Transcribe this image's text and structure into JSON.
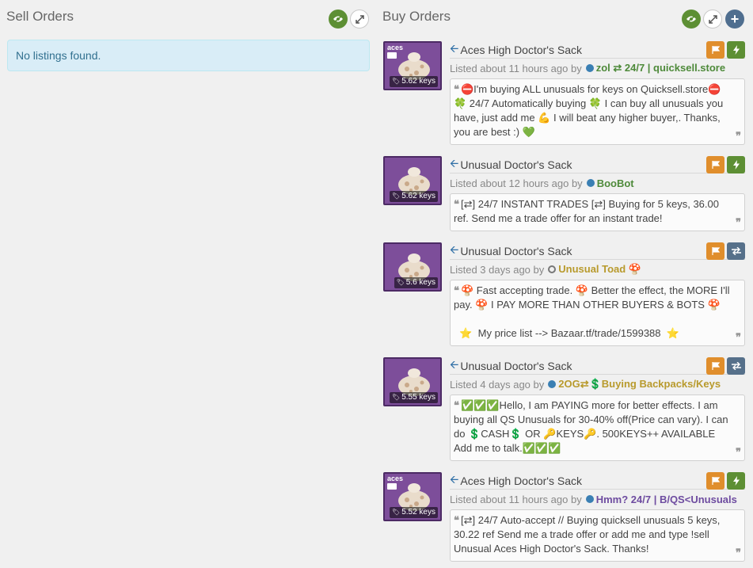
{
  "sell": {
    "title": "Sell Orders",
    "empty_message": "No listings found."
  },
  "buy": {
    "title": "Buy Orders",
    "add_symbol": "+",
    "listings": [
      {
        "thumb_aces": "aces",
        "price": "5.62 keys",
        "item_name": "Aces High Doctor's Sack",
        "listed": "Listed about 11 hours ago by",
        "user": "zol ⇄ 24/7 | quicksell.store",
        "desc": "⛔I'm buying ALL unusuals for keys on Quicksell.store⛔\n🍀 24/7 Automatically buying 🍀 I can buy all unusuals you have, just add me 💪 I will beat any higher buyer,. Thanks, you are best :) 💚"
      },
      {
        "price": "5.62 keys",
        "item_name": "Unusual Doctor's Sack",
        "listed": "Listed about 12 hours ago by",
        "user": "BooBot",
        "desc": "[⇄] 24/7 INSTANT TRADES [⇄] Buying for 5 keys, 36.00 ref. Send me a trade offer for an instant trade!"
      },
      {
        "price": "5.6 keys",
        "item_name": "Unusual Doctor's Sack",
        "listed": "Listed 3 days ago by",
        "user": "Unusual Toad 🍄",
        "desc": "🍄 Fast accepting trade. 🍄 Better the effect, the MORE I'll pay. 🍄 I PAY MORE THAN OTHER BUYERS & BOTS 🍄\n\n  ⭐  My price list --> Bazaar.tf/trade/1599388  ⭐"
      },
      {
        "price": "5.55 keys",
        "item_name": "Unusual Doctor's Sack",
        "listed": "Listed 4 days ago by",
        "user": "2OG⇄💲Buying Backpacks/Keys",
        "desc": "✅✅✅Hello, I am PAYING more for better effects. I am buying all QS Unusuals for 30-40% off(Price can vary). I can do 💲CASH💲 OR 🔑KEYS🔑. 500KEYS++ AVAILABLE Add me to talk.✅✅✅"
      },
      {
        "thumb_aces": "aces",
        "price": "5.52 keys",
        "item_name": "Aces High Doctor's Sack",
        "listed": "Listed about 11 hours ago by",
        "user": "Hmm? 24/7 | B/QS<Unusuals",
        "desc": "[⇄] 24/7 Auto-accept // Buying quicksell unusuals 5 keys, 30.22 ref Send me a trade offer or add me and type !sell Unusual Aces High Doctor's Sack. Thanks!"
      }
    ]
  },
  "icons": {
    "visibility": "eye-icon",
    "expand": "expand-icon",
    "add": "plus-icon",
    "back": "arrow-left-icon",
    "report": "flag-icon",
    "instant": "lightning-icon",
    "trade": "exchange-icon",
    "quote_open": "quote-open-icon",
    "quote_close": "quote-close-icon"
  },
  "colors": {
    "green": "#5d8f34",
    "orange": "#e08e2c",
    "slate": "#56708a",
    "info_bg": "#d9edf7",
    "item_bg": "#7d4e9a"
  }
}
